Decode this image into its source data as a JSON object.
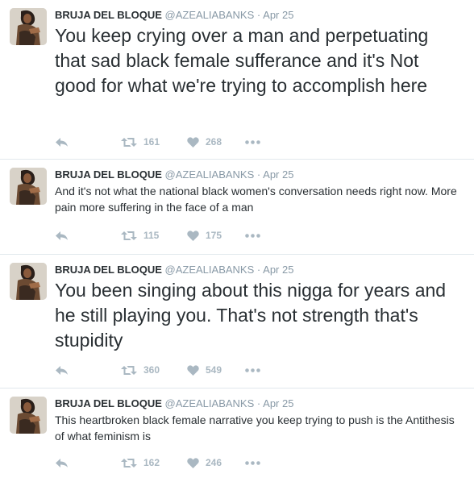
{
  "author": {
    "name": "BRUJA DEL BLOQUE",
    "handle": "@AZEALIABANKS",
    "separator": "·"
  },
  "tweets": [
    {
      "time": "Apr 25",
      "text": "You keep crying over a man and perpetuating that sad black female sufferance and it's Not good for what we're trying to accomplish here",
      "retweets": "161",
      "likes": "268"
    },
    {
      "time": "Apr 25",
      "text": "And it's not what the national black women's conversation needs right now. More pain more suffering in the face of a man",
      "retweets": "115",
      "likes": "175"
    },
    {
      "time": "Apr 25",
      "text": "You been singing about this nigga for years and he still playing you. That's not strength that's stupidity",
      "retweets": "360",
      "likes": "549"
    },
    {
      "time": "Apr 25",
      "text": "This heartbroken black female narrative you keep trying to push is the Antithesis of what feminism is",
      "retweets": "162",
      "likes": "246"
    }
  ],
  "icons": {
    "reply": "reply-icon",
    "retweet": "retweet-icon",
    "like": "heart-icon",
    "more": "more-icon",
    "avatar": "profile-photo"
  },
  "colors": {
    "text": "#292f33",
    "muted": "#8899a6",
    "action": "#aab8c2",
    "divider": "#e1e8ed"
  }
}
